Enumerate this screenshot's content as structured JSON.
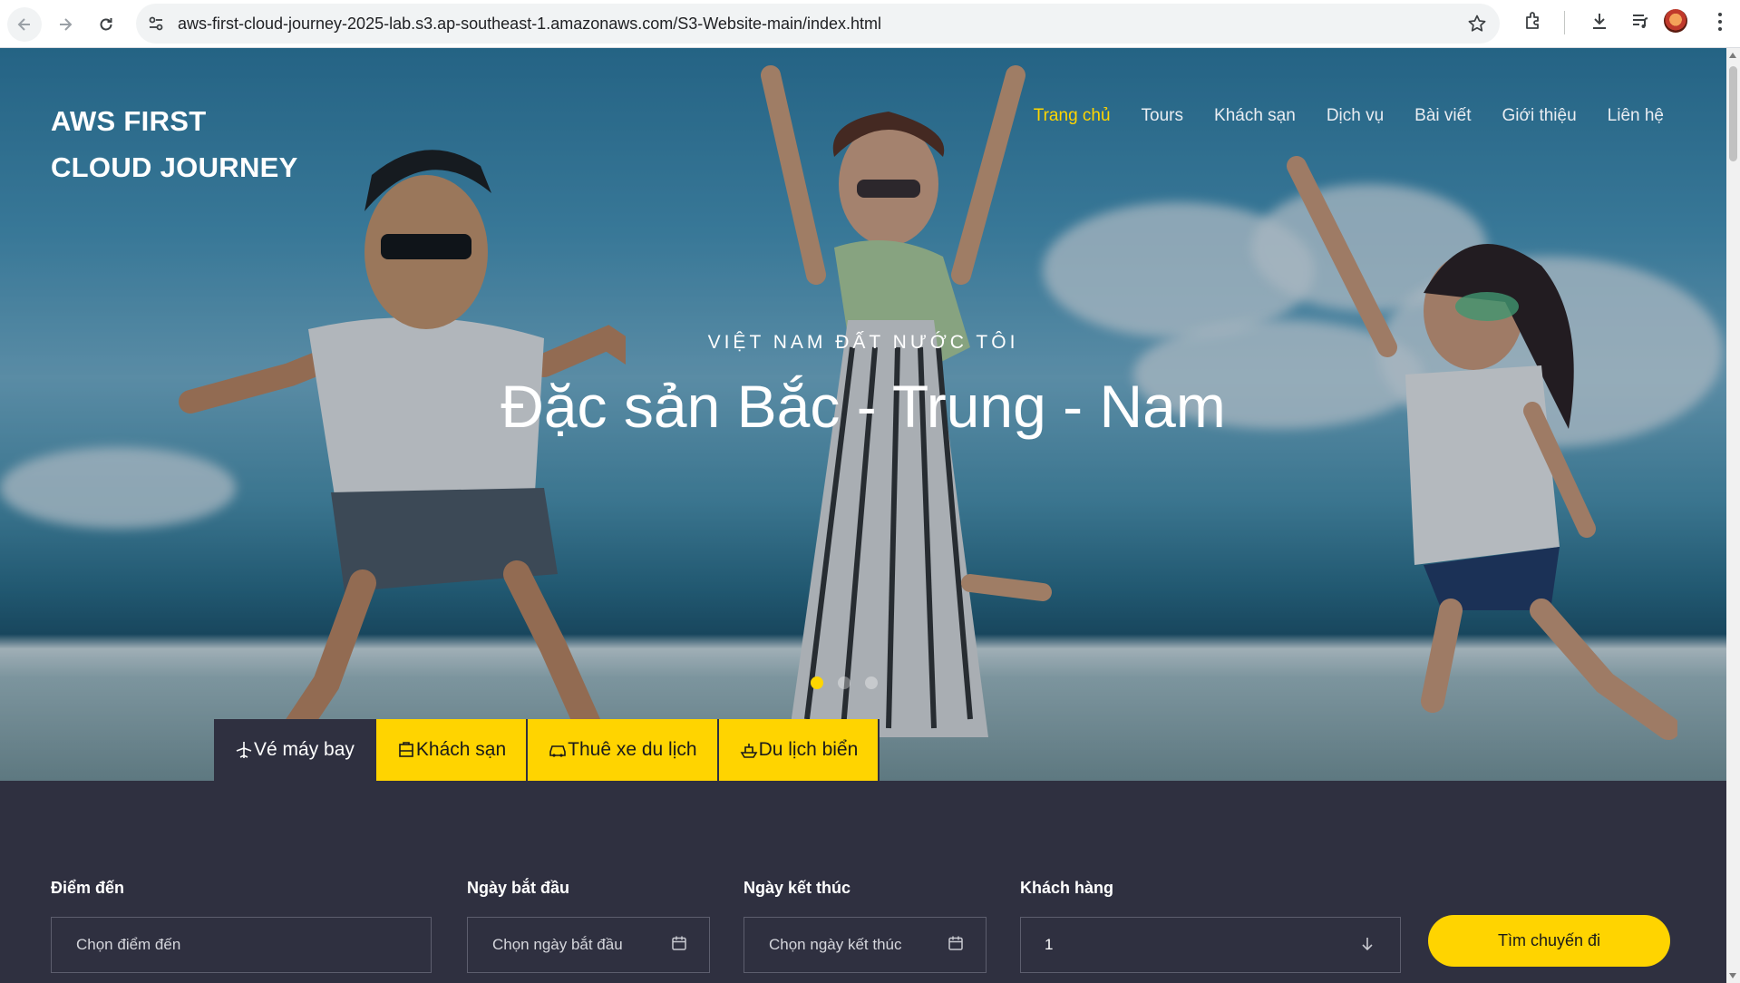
{
  "browser": {
    "url": "aws-first-cloud-journey-2025-lab.s3.ap-southeast-1.amazonaws.com/S3-Website-main/index.html",
    "icons": [
      "back-arrow-icon",
      "forward-arrow-icon",
      "reload-icon",
      "site-settings-icon",
      "bookmark-star-icon",
      "extensions-icon",
      "download-icon",
      "media-control-icon",
      "profile-avatar",
      "kebab-menu-icon"
    ]
  },
  "site": {
    "brand_line1": "AWS FIRST",
    "brand_line2": "CLOUD JOURNEY",
    "nav": [
      {
        "label": "Trang chủ",
        "active": true
      },
      {
        "label": "Tours",
        "active": false
      },
      {
        "label": "Khách sạn",
        "active": false
      },
      {
        "label": "Dịch vụ",
        "active": false
      },
      {
        "label": "Bài viết",
        "active": false
      },
      {
        "label": "Giới thiệu",
        "active": false
      },
      {
        "label": "Liên hệ",
        "active": false
      }
    ],
    "accent_color": "#ffd400",
    "panel_color": "#2f3040"
  },
  "hero": {
    "eyebrow": "VIỆT NAM ĐẤT NƯỚC TÔI",
    "headline": "Đặc sản Bắc - Trung - Nam",
    "slide_count": 3,
    "active_slide": 1
  },
  "tabs": [
    {
      "label": "Vé máy bay",
      "icon": "airplane-icon",
      "active": true
    },
    {
      "label": "Khách sạn",
      "icon": "hotel-icon",
      "active": false
    },
    {
      "label": "Thuê xe du lịch",
      "icon": "car-icon",
      "active": false
    },
    {
      "label": "Du lịch biển",
      "icon": "ship-icon",
      "active": false
    }
  ],
  "search": {
    "destination_label": "Điểm đến",
    "destination_placeholder": "Chọn điểm đến",
    "start_label": "Ngày bắt đầu",
    "start_placeholder": "Chọn ngày bắt đầu",
    "end_label": "Ngày kết thúc",
    "end_placeholder": "Chọn ngày kết thúc",
    "guests_label": "Khách hàng",
    "guests_value": "1",
    "submit_label": "Tìm chuyến đi"
  }
}
